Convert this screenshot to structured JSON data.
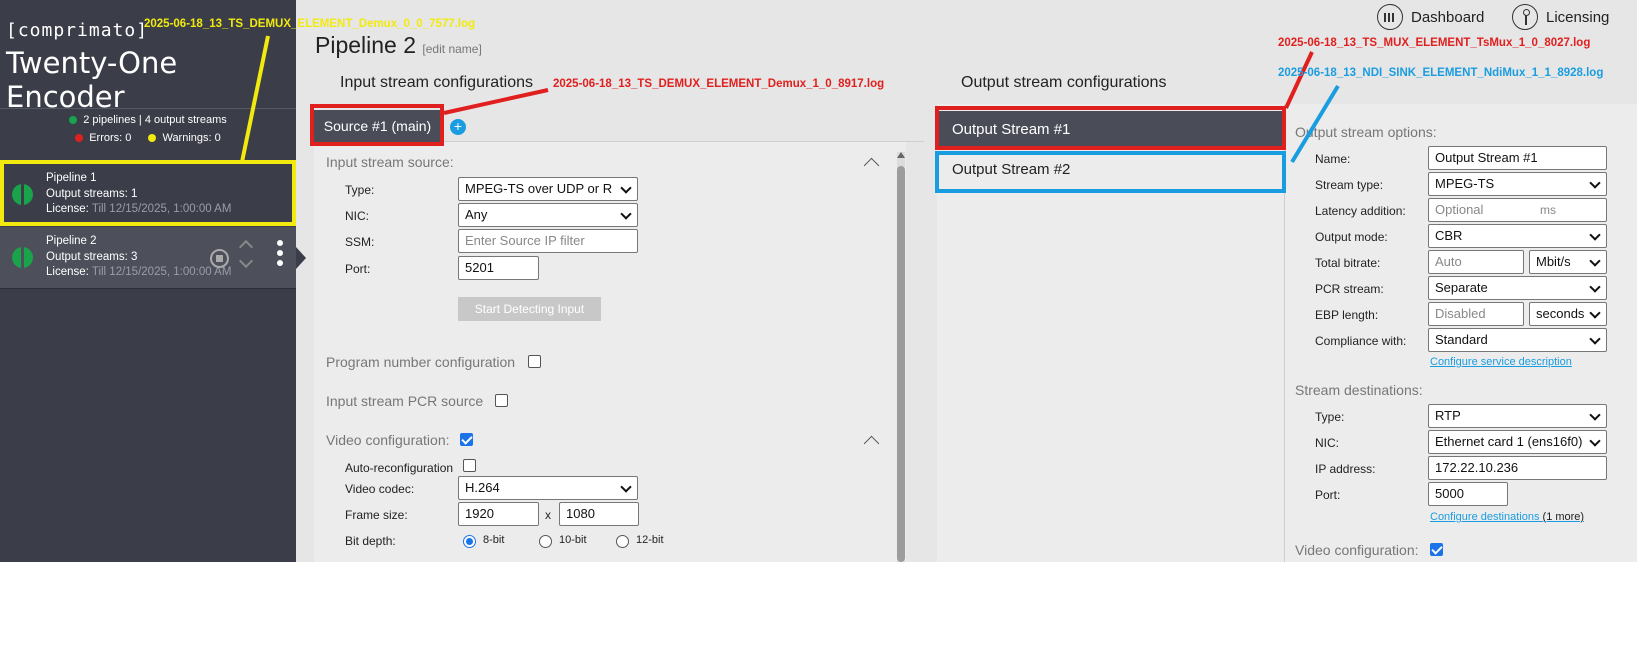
{
  "sidebar": {
    "brand_small": "[comprimato]",
    "brand_title": "Twenty-One Encoder",
    "stats_summary": "2 pipelines | 4 output streams",
    "errors_label": "Errors: 0",
    "warnings_label": "Warnings: 0",
    "status_colors": {
      "ok": "#19a34a",
      "error": "#e0201f",
      "warning": "#f2ea0f"
    },
    "pipelines": [
      {
        "name": "Pipeline 1",
        "streams": "Output streams: 1",
        "license_label": "License:",
        "license_value": "Till 12/15/2025, 1:00:00 AM"
      },
      {
        "name": "Pipeline 2",
        "streams": "Output streams: 3",
        "license_label": "License:",
        "license_value": "Till 12/15/2025, 1:00:00 AM"
      }
    ]
  },
  "topnav": {
    "dashboard": "Dashboard",
    "licensing": "Licensing"
  },
  "pipeline": {
    "title": "Pipeline 2",
    "edit_name": "[edit name]"
  },
  "input": {
    "heading": "Input stream configurations",
    "source_tab": "Source #1 (main)",
    "add_icon": "+",
    "source_group": "Input stream source:",
    "type_label": "Type:",
    "type_value": "MPEG-TS over UDP or R",
    "nic_label": "NIC:",
    "nic_value": "Any",
    "ssm_label": "SSM:",
    "ssm_placeholder": "Enter Source IP filter",
    "port_label": "Port:",
    "port_value": "5201",
    "detect_button": "Start Detecting Input",
    "program_number": "Program number configuration",
    "pcr_source": "Input stream PCR source",
    "video_config": "Video configuration:",
    "auto_reconfig": "Auto-reconfiguration",
    "codec_label": "Video codec:",
    "codec_value": "H.264",
    "frame_label": "Frame size:",
    "frame_w": "1920",
    "frame_x": "x",
    "frame_h": "1080",
    "bitdepth_label": "Bit depth:",
    "bitdepth_options": [
      "8-bit",
      "10-bit",
      "12-bit"
    ],
    "bitdepth_selected": "8-bit"
  },
  "output": {
    "heading": "Output stream configurations",
    "streams": [
      "Output Stream #1",
      "Output Stream #2"
    ],
    "options_title": "Output stream options:",
    "name_label": "Name:",
    "name_value": "Output Stream #1",
    "stream_type_label": "Stream type:",
    "stream_type_value": "MPEG-TS",
    "latency_label": "Latency addition:",
    "latency_placeholder": "Optional",
    "latency_unit": "ms",
    "output_mode_label": "Output mode:",
    "output_mode_value": "CBR",
    "total_bitrate_label": "Total bitrate:",
    "total_bitrate_placeholder": "Auto",
    "bitrate_unit": "Mbit/s",
    "pcr_label": "PCR stream:",
    "pcr_value": "Separate",
    "ebp_label": "EBP length:",
    "ebp_placeholder": "Disabled",
    "ebp_unit": "seconds",
    "compliance_label": "Compliance with:",
    "compliance_value": "Standard",
    "service_link": "Configure service description",
    "dest_title": "Stream destinations:",
    "dest_type_label": "Type:",
    "dest_type_value": "RTP",
    "dest_nic_label": "NIC:",
    "dest_nic_value": "Ethernet card 1 (ens16f0)",
    "ip_label": "IP address:",
    "ip_value": "172.22.10.236",
    "dest_port_label": "Port:",
    "dest_port_value": "5000",
    "dest_link": "Configure destinations",
    "dest_more": "(1 more)",
    "video_config": "Video configuration:"
  },
  "annotations": {
    "yellow_log": "2025-06-18_13_TS_DEMUX_ELEMENT_Demux_0_0_7577.log",
    "red_demux_log": "2025-06-18_13_TS_DEMUX_ELEMENT_Demux_1_0_8917.log",
    "red_mux_log": "2025-06-18_13_TS_MUX_ELEMENT_TsMux_1_0_8027.log",
    "cyan_ndi_log": "2025-06-18_13_NDI_SINK_ELEMENT_NdiMux_1_1_8928.log",
    "colors": {
      "red": "#e0201f",
      "yellow": "#f2ea0f",
      "cyan": "#1a9de0"
    }
  }
}
